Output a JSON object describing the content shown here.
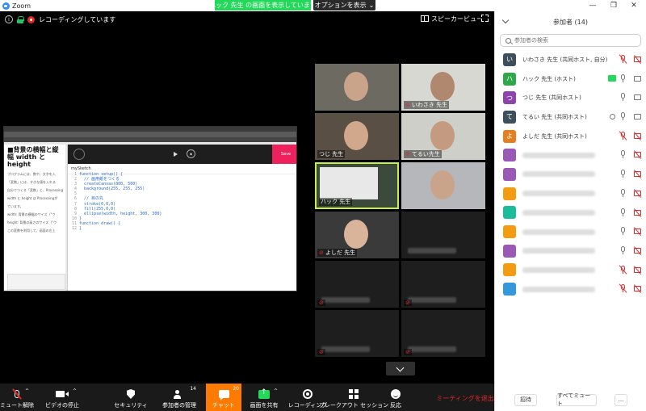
{
  "window": {
    "app_title": "Zoom",
    "controls": {
      "minimize": "—",
      "maximize": "❐",
      "close": "✕"
    }
  },
  "share_banner": {
    "text": "ハック 先生 の画面を表示しています",
    "options_label": "オプションを表示",
    "options_caret": "⌄"
  },
  "status": {
    "info_glyph": "i",
    "recording_label": "レコーディングしています"
  },
  "view": {
    "speaker_view_label": "スピーカービュー"
  },
  "shared_screen": {
    "doc_title": "■背景の横幅と縦幅 width と height",
    "doc_lines": [
      "プログラムには、数や、文字を入",
      "「変数」には、すきな値を入れる",
      "自分でつくる「変数」と、Processing",
      "width と height は Processingが",
      "ています。",
      "width: 背景の横幅のサイズ（\"ウ",
      "height: 背景の高さのサイズ（\"ウ",
      "この変数を利用して、画面の左上"
    ],
    "sketch_name": "mySketch",
    "save_label": "Save",
    "stop_glyph": "◼",
    "code_lines": [
      {
        "n": "1",
        "t": "function setup() {"
      },
      {
        "n": "2",
        "t": "  // 画用紙をつくる"
      },
      {
        "n": "3",
        "t": "  createCanvas(800, 500)"
      },
      {
        "n": "4",
        "t": "  background(255, 255, 255)"
      },
      {
        "n": "5",
        "t": ""
      },
      {
        "n": "6",
        "t": "  // 目の丸"
      },
      {
        "n": "7",
        "t": "  stroke(0,0,0)"
      },
      {
        "n": "8",
        "t": "  fill(255,0,0)"
      },
      {
        "n": "9",
        "t": "  ellipse(width, height, 300, 300)"
      },
      {
        "n": "10",
        "t": "}"
      },
      {
        "n": "11",
        "t": "function draw() {"
      },
      {
        "n": "12",
        "t": "}"
      }
    ]
  },
  "video_tiles": [
    {
      "name": "",
      "muted": false
    },
    {
      "name": "いわさき 先生",
      "muted": true
    },
    {
      "name": "つじ 先生",
      "muted": false
    },
    {
      "name": "てるい先生",
      "muted": true
    },
    {
      "name": "ハック 先生",
      "muted": false
    },
    {
      "name": "",
      "muted": false
    },
    {
      "name": "よしだ 先生",
      "muted": true
    },
    {
      "name": "",
      "muted": false
    },
    {
      "name": "",
      "muted": true
    },
    {
      "name": "",
      "muted": true
    },
    {
      "name": "",
      "muted": true
    },
    {
      "name": "",
      "muted": true
    }
  ],
  "toolbar": {
    "mute_label": "ミュート解除",
    "mute_caret": "^",
    "video_label": "ビデオの停止",
    "video_caret": "^",
    "security_label": "セキュリティ",
    "participants_label": "参加者の管理",
    "participants_count": "14",
    "chat_label": "チャット",
    "chat_count": "20",
    "share_label": "画面を共有",
    "share_caret": "^",
    "record_label": "レコーディング",
    "breakout_label": "ブレークアウト セッション",
    "reactions_label": "反応",
    "leave_label": "ミーティングを退出"
  },
  "panel": {
    "title": "参加者 (14)",
    "search_placeholder": "参加者の検索",
    "participants": [
      {
        "initial": "い",
        "name": "いわさき 先生 (共同ホスト, 自分)",
        "color": "#3d4f5c",
        "mic": "muted",
        "cam": "muted"
      },
      {
        "initial": "ハ",
        "name": "ハック 先生 (ホスト)",
        "color": "#2ea84a",
        "mic": "on",
        "cam": "on",
        "sharing": true
      },
      {
        "initial": "つ",
        "name": "つじ 先生 (共同ホスト)",
        "color": "#8e44ad",
        "mic": "on",
        "cam": "on"
      },
      {
        "initial": "て",
        "name": "てるい 先生 (共同ホスト)",
        "color": "#3d4f5c",
        "mic": "on",
        "cam": "on",
        "annotating": true
      },
      {
        "initial": "よ",
        "name": "よしだ 先生 (共同ホスト)",
        "color": "#e67e22",
        "mic": "muted",
        "cam": "muted"
      },
      {
        "initial": "",
        "name": "",
        "color": "#9b59b6",
        "mic": "on",
        "cam": "muted"
      },
      {
        "initial": "",
        "name": "",
        "color": "#9b59b6",
        "mic": "on",
        "cam": "muted"
      },
      {
        "initial": "",
        "name": "",
        "color": "#f39c12",
        "mic": "on",
        "cam": "muted"
      },
      {
        "initial": "",
        "name": "",
        "color": "#1abc9c",
        "mic": "on",
        "cam": "muted"
      },
      {
        "initial": "",
        "name": "",
        "color": "#f39c12",
        "mic": "on",
        "cam": "muted"
      },
      {
        "initial": "",
        "name": "",
        "color": "#9b59b6",
        "mic": "on",
        "cam": "muted"
      },
      {
        "initial": "",
        "name": "",
        "color": "#f39c12",
        "mic": "muted",
        "cam": "muted"
      },
      {
        "initial": "",
        "name": "",
        "color": "#3498db",
        "mic": "muted",
        "cam": "muted"
      }
    ],
    "invite_label": "招待",
    "mute_all_label": "すべてミュート",
    "more_label": "..."
  }
}
